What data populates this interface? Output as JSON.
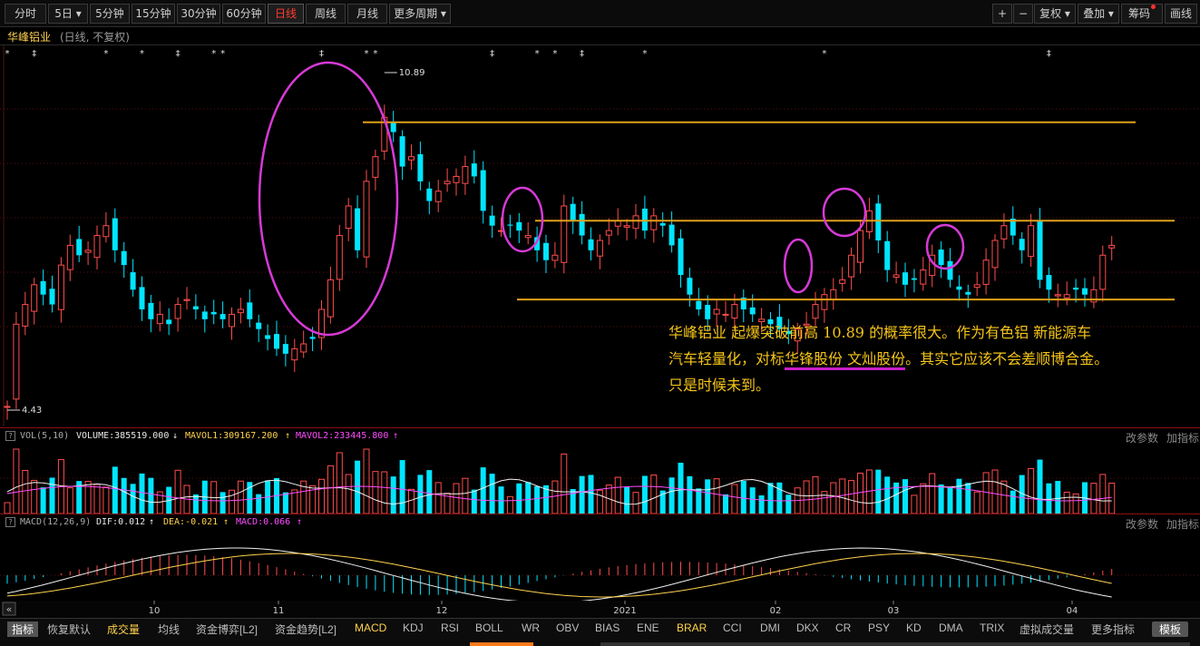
{
  "toolbar": {
    "tabs": [
      "分时",
      "5日",
      "5分钟",
      "15分钟",
      "30分钟",
      "60分钟",
      "日线",
      "周线",
      "月线",
      "更多周期"
    ],
    "active_tab": "日线",
    "right": [
      "复权",
      "叠加",
      "筹码",
      "画线"
    ]
  },
  "stock": {
    "name": "华峰铝业",
    "sub": "(日线, 不复权)"
  },
  "price_labels": {
    "high": "10.89",
    "low": "4.43"
  },
  "annotation": {
    "line1": "华峰铝业 起爆突破前高 10.89 的概率很大。作为有色铝 新能源车",
    "line2_a": "汽车轻量化，对标",
    "line2_b": "华锋股份 文灿股份",
    "line2_c": "。其实它应该不会差顺博合金。",
    "line3": "只是时候未到。"
  },
  "vol_panel": {
    "q": "?",
    "title": "VOL(5,10)",
    "volume": "VOLUME:385519.000",
    "mavol1": "MAVOL1:309167.200",
    "mavol2": "MAVOL2:233445.800",
    "btn_params": "改参数",
    "btn_add": "加指标"
  },
  "macd_panel": {
    "q": "?",
    "title": "MACD(12,26,9)",
    "dif": "DIF:0.012",
    "dea": "DEA:-0.021",
    "macd": "MACD:0.066",
    "btn_params": "改参数",
    "btn_add": "加指标"
  },
  "axis": {
    "scroll_btn": "«",
    "months": [
      "10",
      "11",
      "12",
      "2021",
      "02",
      "03",
      "04"
    ]
  },
  "bottom_tabs": [
    "指标",
    "恢复默认",
    "成交量",
    "均线",
    "资金博弈[L2]",
    "资金趋势[L2]",
    "MACD",
    "KDJ",
    "RSI",
    "BOLL",
    "WR",
    "OBV",
    "BIAS",
    "ENE",
    "BRAR",
    "CCI",
    "DMI",
    "DKX",
    "CR",
    "PSY",
    "KD",
    "DMA",
    "TRIX",
    "虚拟成交量",
    "更多指标",
    "模板"
  ],
  "colors": {
    "up": "#ff4c4c",
    "down": "#00e5ff",
    "accent": "#ffd24d",
    "gold": "#e0a01a",
    "circle": "#d63ad6"
  },
  "chart_data": {
    "type": "candlestick",
    "high_label": 10.89,
    "low_label": 4.43,
    "resistance_lines": [
      10.2,
      8.2
    ],
    "support_line": 6.6,
    "closes": [
      4.43,
      6.1,
      6.5,
      6.9,
      6.7,
      6.5,
      7.3,
      7.7,
      7.5,
      7.6,
      7.9,
      8.1,
      7.6,
      7.3,
      6.8,
      6.4,
      6.2,
      6.3,
      6.1,
      6.5,
      6.6,
      6.4,
      6.2,
      6.3,
      6.2,
      6.3,
      6.4,
      6.2,
      6.0,
      5.8,
      5.6,
      5.5,
      5.6,
      5.7,
      5.8,
      6.4,
      7.0,
      7.9,
      8.5,
      7.6,
      9.0,
      9.5,
      10.3,
      10.0,
      9.3,
      9.5,
      9.0,
      8.6,
      8.8,
      9.0,
      9.1,
      9.3,
      9.1,
      8.4,
      8.1,
      8.0,
      8.1,
      8.0,
      7.9,
      7.6,
      7.4,
      7.5,
      8.5,
      8.2,
      7.9,
      7.6,
      7.8,
      8.0,
      8.2,
      8.1,
      8.3,
      8.0,
      8.3,
      8.1,
      7.7,
      7.1,
      6.7,
      6.4,
      6.2,
      6.4,
      6.3,
      6.5,
      6.4,
      6.3,
      6.2,
      6.1,
      6.0,
      5.9,
      6.0,
      6.1,
      6.5,
      6.7,
      6.8,
      7.0,
      7.5,
      8.0,
      8.4,
      7.8,
      7.2,
      7.1,
      6.9,
      7.0,
      7.2,
      7.5,
      7.3,
      7.0,
      6.8,
      6.7,
      6.9,
      7.4,
      7.8,
      8.1,
      7.9,
      7.6,
      8.1,
      7.0,
      6.8,
      6.7,
      6.7,
      6.8,
      6.7,
      6.8,
      7.5,
      7.7
    ],
    "ylim": [
      4.3,
      11.3
    ]
  }
}
